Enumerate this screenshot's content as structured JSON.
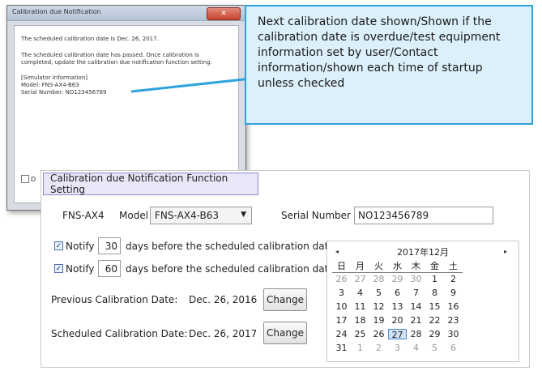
{
  "notification": {
    "title": "Calibration due Notification",
    "close_symbol": "✕",
    "line1": "The scheduled calibration date is Dec. 26, 2017.",
    "line2a": "The scheduled calibration date has passed. Once calibration is",
    "line2b": "completed, update the calibration due notification function setting.",
    "sim_header": "[Simulator Information]",
    "sim_model": "Model: FNS-AX4-B63",
    "sim_serial": "Serial Number: NO123456789",
    "checkbox_label": "D"
  },
  "callout": {
    "text": "Next calibration date shown/Shown if the calibration date is overdue/test equipment information set by user/Contact information/shown each time of startup unless checked"
  },
  "settings": {
    "tab_label": "Calibration due Notification Function Setting",
    "device_name": "FNS-AX4",
    "model_label": "Model",
    "model_value": "FNS-AX4-B63",
    "serial_label": "Serial Number",
    "serial_value": "NO123456789",
    "notify_rows": [
      {
        "checked": true,
        "label": "Notify",
        "days": "30",
        "suffix": "days before the scheduled calibration date"
      },
      {
        "checked": true,
        "label": "Notify",
        "days": "60",
        "suffix": "days before the scheduled calibration date"
      }
    ],
    "previous_label": "Previous Calibration Date:",
    "previous_value": "Dec. 26, 2016",
    "scheduled_label": "Scheduled Calibration Date:",
    "scheduled_value": "Dec. 26, 2017",
    "change_label": "Change",
    "check_mark": "✓"
  },
  "calendar": {
    "title": "2017年12月",
    "prev_symbol": "◂",
    "next_symbol": "▸",
    "weekdays": [
      "日",
      "月",
      "火",
      "水",
      "木",
      "金",
      "土"
    ],
    "weeks": [
      [
        "26",
        "27",
        "28",
        "29",
        "30",
        "1",
        "2"
      ],
      [
        "3",
        "4",
        "5",
        "6",
        "7",
        "8",
        "9"
      ],
      [
        "10",
        "11",
        "12",
        "13",
        "14",
        "15",
        "16"
      ],
      [
        "17",
        "18",
        "19",
        "20",
        "21",
        "22",
        "23"
      ],
      [
        "24",
        "25",
        "26",
        "27",
        "28",
        "29",
        "30"
      ],
      [
        "31",
        "1",
        "2",
        "3",
        "4",
        "5",
        "6"
      ]
    ],
    "highlighted": "27"
  },
  "colors": {
    "callout_border": "#2fa3dc",
    "callout_fill": "#dcf0fb",
    "tab_fill": "#e7e7f8",
    "today_fill": "#cfe2f6"
  }
}
